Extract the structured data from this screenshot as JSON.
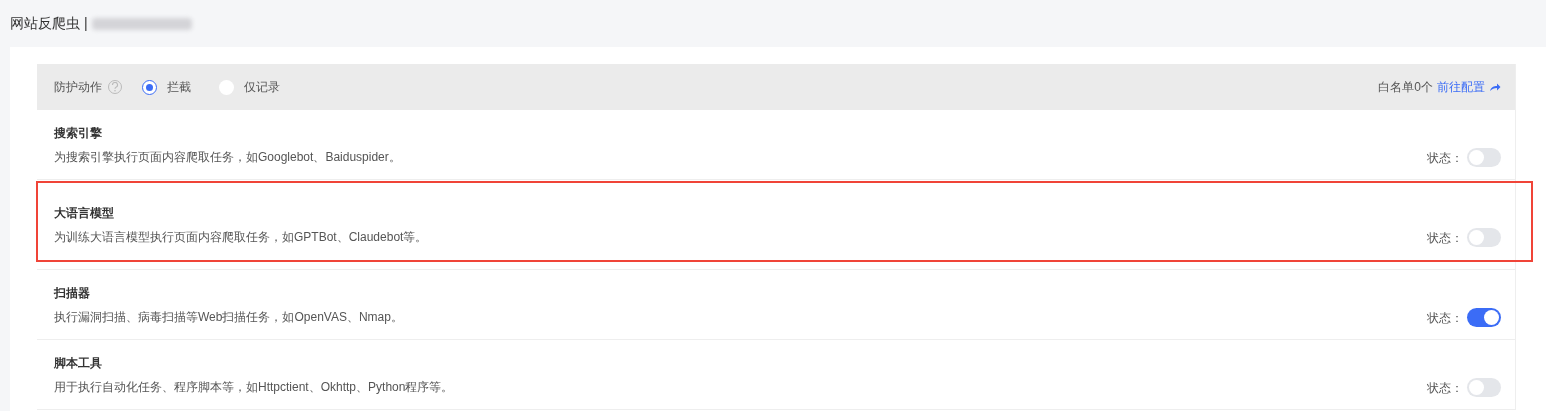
{
  "page": {
    "title": "网站反爬虫 |"
  },
  "header": {
    "label": "防护动作",
    "options": [
      {
        "label": "拦截",
        "selected": true
      },
      {
        "label": "仅记录",
        "selected": false
      }
    ],
    "whitelist": "白名单0个",
    "link": "前往配置"
  },
  "rows": [
    {
      "title": "搜索引擎",
      "description": "为搜索引擎执行页面内容爬取任务，如Googlebot、Baiduspider。",
      "status_label": "状态：",
      "on": false,
      "highlighted": false
    },
    {
      "title": "大语言模型",
      "description": "为训练大语言模型执行页面内容爬取任务，如GPTBot、Claudebot等。",
      "status_label": "状态：",
      "on": false,
      "highlighted": true
    },
    {
      "title": "扫描器",
      "description": "执行漏洞扫描、病毒扫描等Web扫描任务，如OpenVAS、Nmap。",
      "status_label": "状态：",
      "on": true,
      "highlighted": false
    },
    {
      "title": "脚本工具",
      "description": "用于执行自动化任务、程序脚本等，如Httpctient、Okhttp、Python程序等。",
      "status_label": "状态：",
      "on": false,
      "highlighted": false
    }
  ]
}
